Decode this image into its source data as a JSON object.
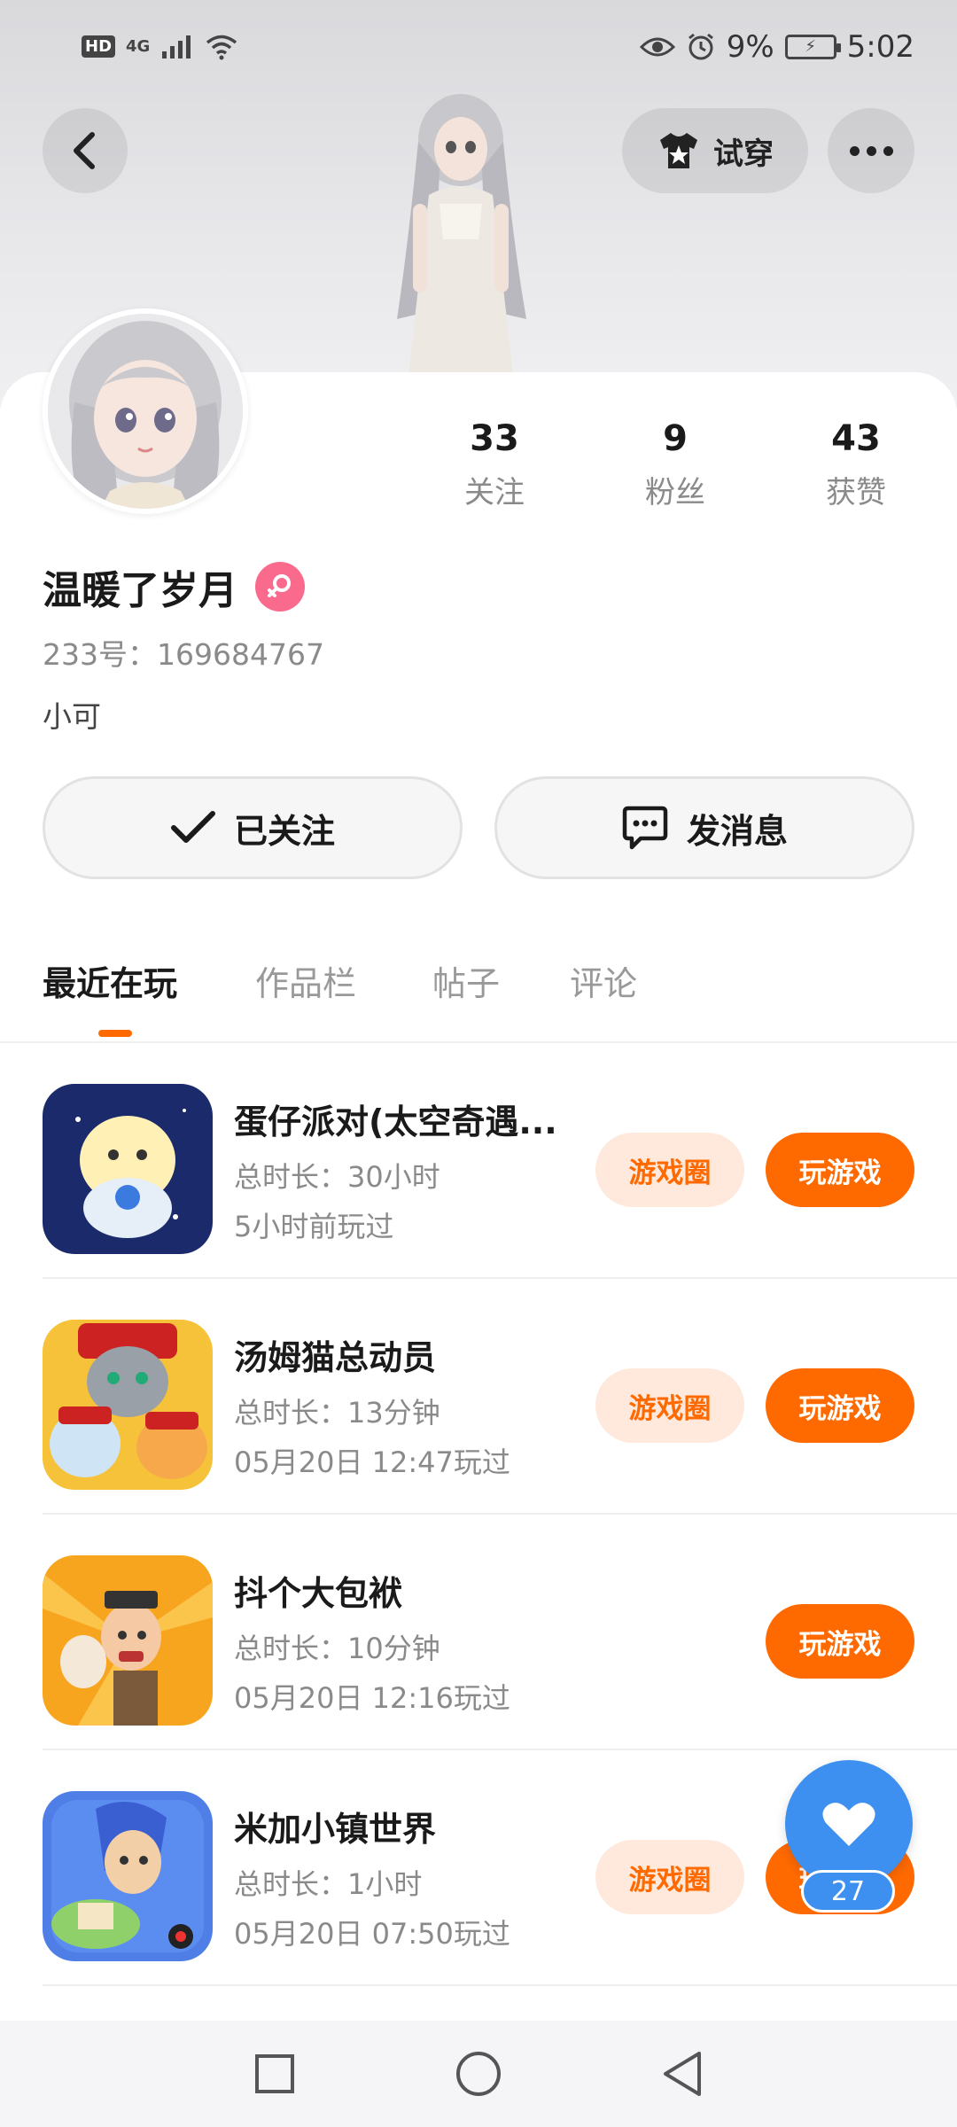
{
  "status_bar": {
    "hd": "HD",
    "network": "4G",
    "battery_percent": "9%",
    "time": "5:02"
  },
  "header": {
    "try_on_label": "试穿"
  },
  "profile": {
    "following_count": "33",
    "following_label": "关注",
    "followers_count": "9",
    "followers_label": "粉丝",
    "likes_count": "43",
    "likes_label": "获赞",
    "username": "温暖了岁月",
    "gender": "female",
    "uid_text": "233号：169684767",
    "bio": "小可"
  },
  "actions": {
    "followed_label": "已关注",
    "message_label": "发消息"
  },
  "tabs": [
    {
      "label": "最近在玩",
      "active": true
    },
    {
      "label": "作品栏",
      "active": false
    },
    {
      "label": "帖子",
      "active": false
    },
    {
      "label": "评论",
      "active": false
    }
  ],
  "games": [
    {
      "title": "蛋仔派对(太空奇遇...",
      "duration": "总时长：30小时",
      "last_played": "5小时前玩过",
      "has_circle": true,
      "icon": "eggy-party-icon"
    },
    {
      "title": "汤姆猫总动员",
      "duration": "总时长：13分钟",
      "last_played": "05月20日 12:47玩过",
      "has_circle": true,
      "icon": "tom-cat-icon"
    },
    {
      "title": "抖个大包袱",
      "duration": "总时长：10分钟",
      "last_played": "05月20日 12:16玩过",
      "has_circle": false,
      "icon": "baofu-game-icon"
    },
    {
      "title": "米加小镇世界",
      "duration": "总时长：1小时",
      "last_played": "05月20日 07:50玩过",
      "has_circle": true,
      "icon": "miga-town-icon"
    }
  ],
  "game_buttons": {
    "circle_label": "游戏圈",
    "play_label": "玩游戏"
  },
  "like_fab": {
    "count": "27"
  },
  "colors": {
    "accent": "#ff6a00",
    "accent_light": "#ffe9dc",
    "fab_blue": "#3d8ff0",
    "gender_pink": "#fa6a8c"
  }
}
